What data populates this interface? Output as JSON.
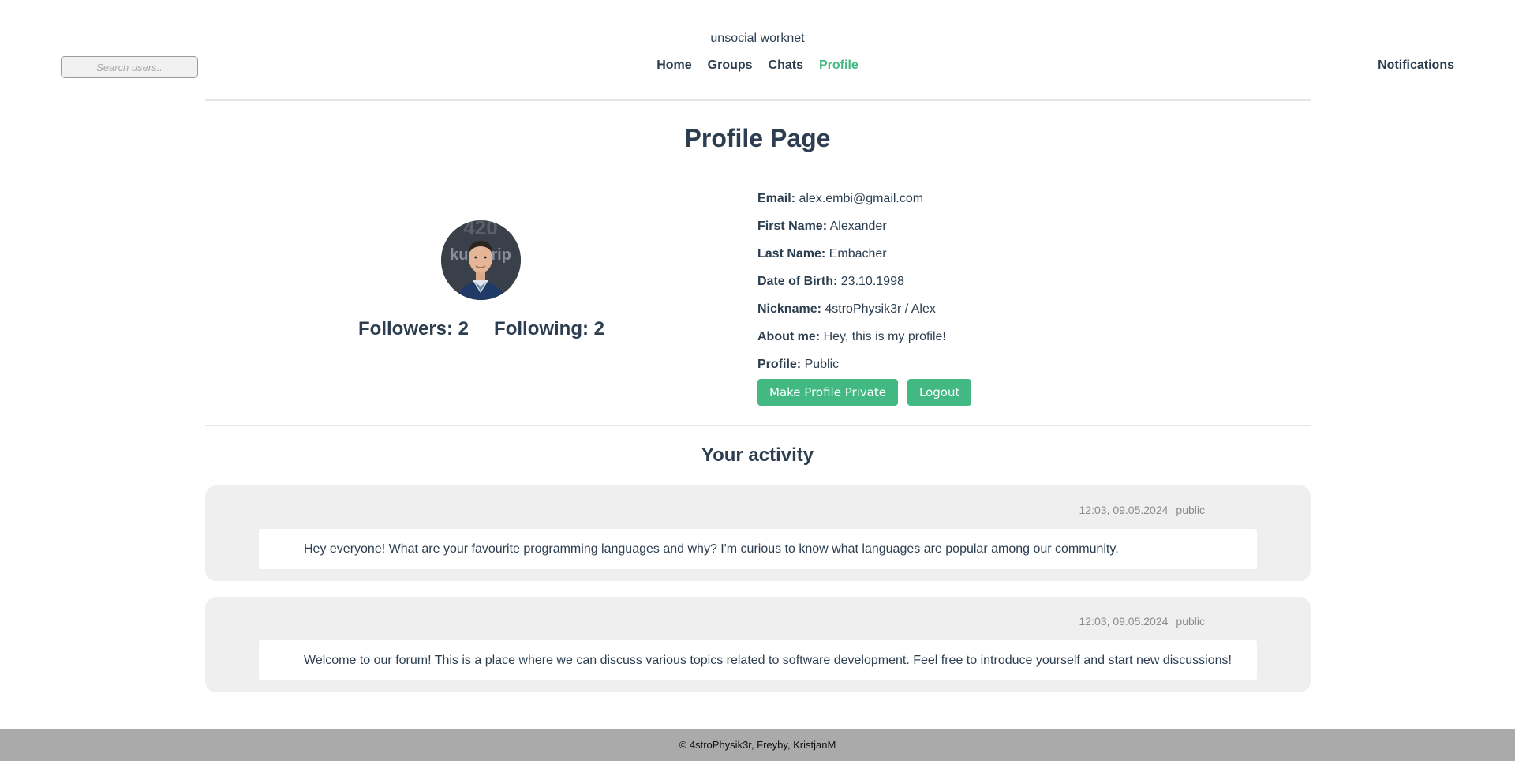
{
  "header": {
    "site_title": "unsocial worknet",
    "search_placeholder": "Search users..",
    "nav": [
      {
        "label": "Home",
        "active": false
      },
      {
        "label": "Groups",
        "active": false
      },
      {
        "label": "Chats",
        "active": false
      },
      {
        "label": "Profile",
        "active": true
      }
    ],
    "notifications_label": "Notifications"
  },
  "profile": {
    "page_title": "Profile Page",
    "followers_label": "Followers: 2",
    "following_label": "Following: 2",
    "fields": [
      {
        "label": "Email:",
        "value": "alex.embi@gmail.com"
      },
      {
        "label": "First Name:",
        "value": "Alexander"
      },
      {
        "label": "Last Name:",
        "value": "Embacher"
      },
      {
        "label": "Date of Birth:",
        "value": "23.10.1998"
      },
      {
        "label": "Nickname:",
        "value": "4stroPhysik3r / Alex"
      },
      {
        "label": "About me:",
        "value": "Hey, this is my profile!"
      },
      {
        "label": "Profile:",
        "value": "Public"
      }
    ],
    "buttons": {
      "privacy_label": "Make Profile Private",
      "logout_label": "Logout"
    }
  },
  "activity": {
    "title": "Your activity",
    "posts": [
      {
        "time": "12:03, 09.05.2024",
        "visibility": "public",
        "text": "Hey everyone! What are your favourite programming languages and why? I'm curious to know what languages are popular among our community."
      },
      {
        "time": "12:03, 09.05.2024",
        "visibility": "public",
        "text": "Welcome to our forum! This is a place where we can discuss various topics related to software development. Feel free to introduce yourself and start new discussions!"
      }
    ]
  },
  "footer": {
    "text": "© 4stroPhysik3r, Freyby, KristjanM"
  },
  "colors": {
    "accent": "#42b983",
    "text": "#2c3e50",
    "post_bg": "#efefef",
    "footer_bg": "#aaaaaa"
  }
}
